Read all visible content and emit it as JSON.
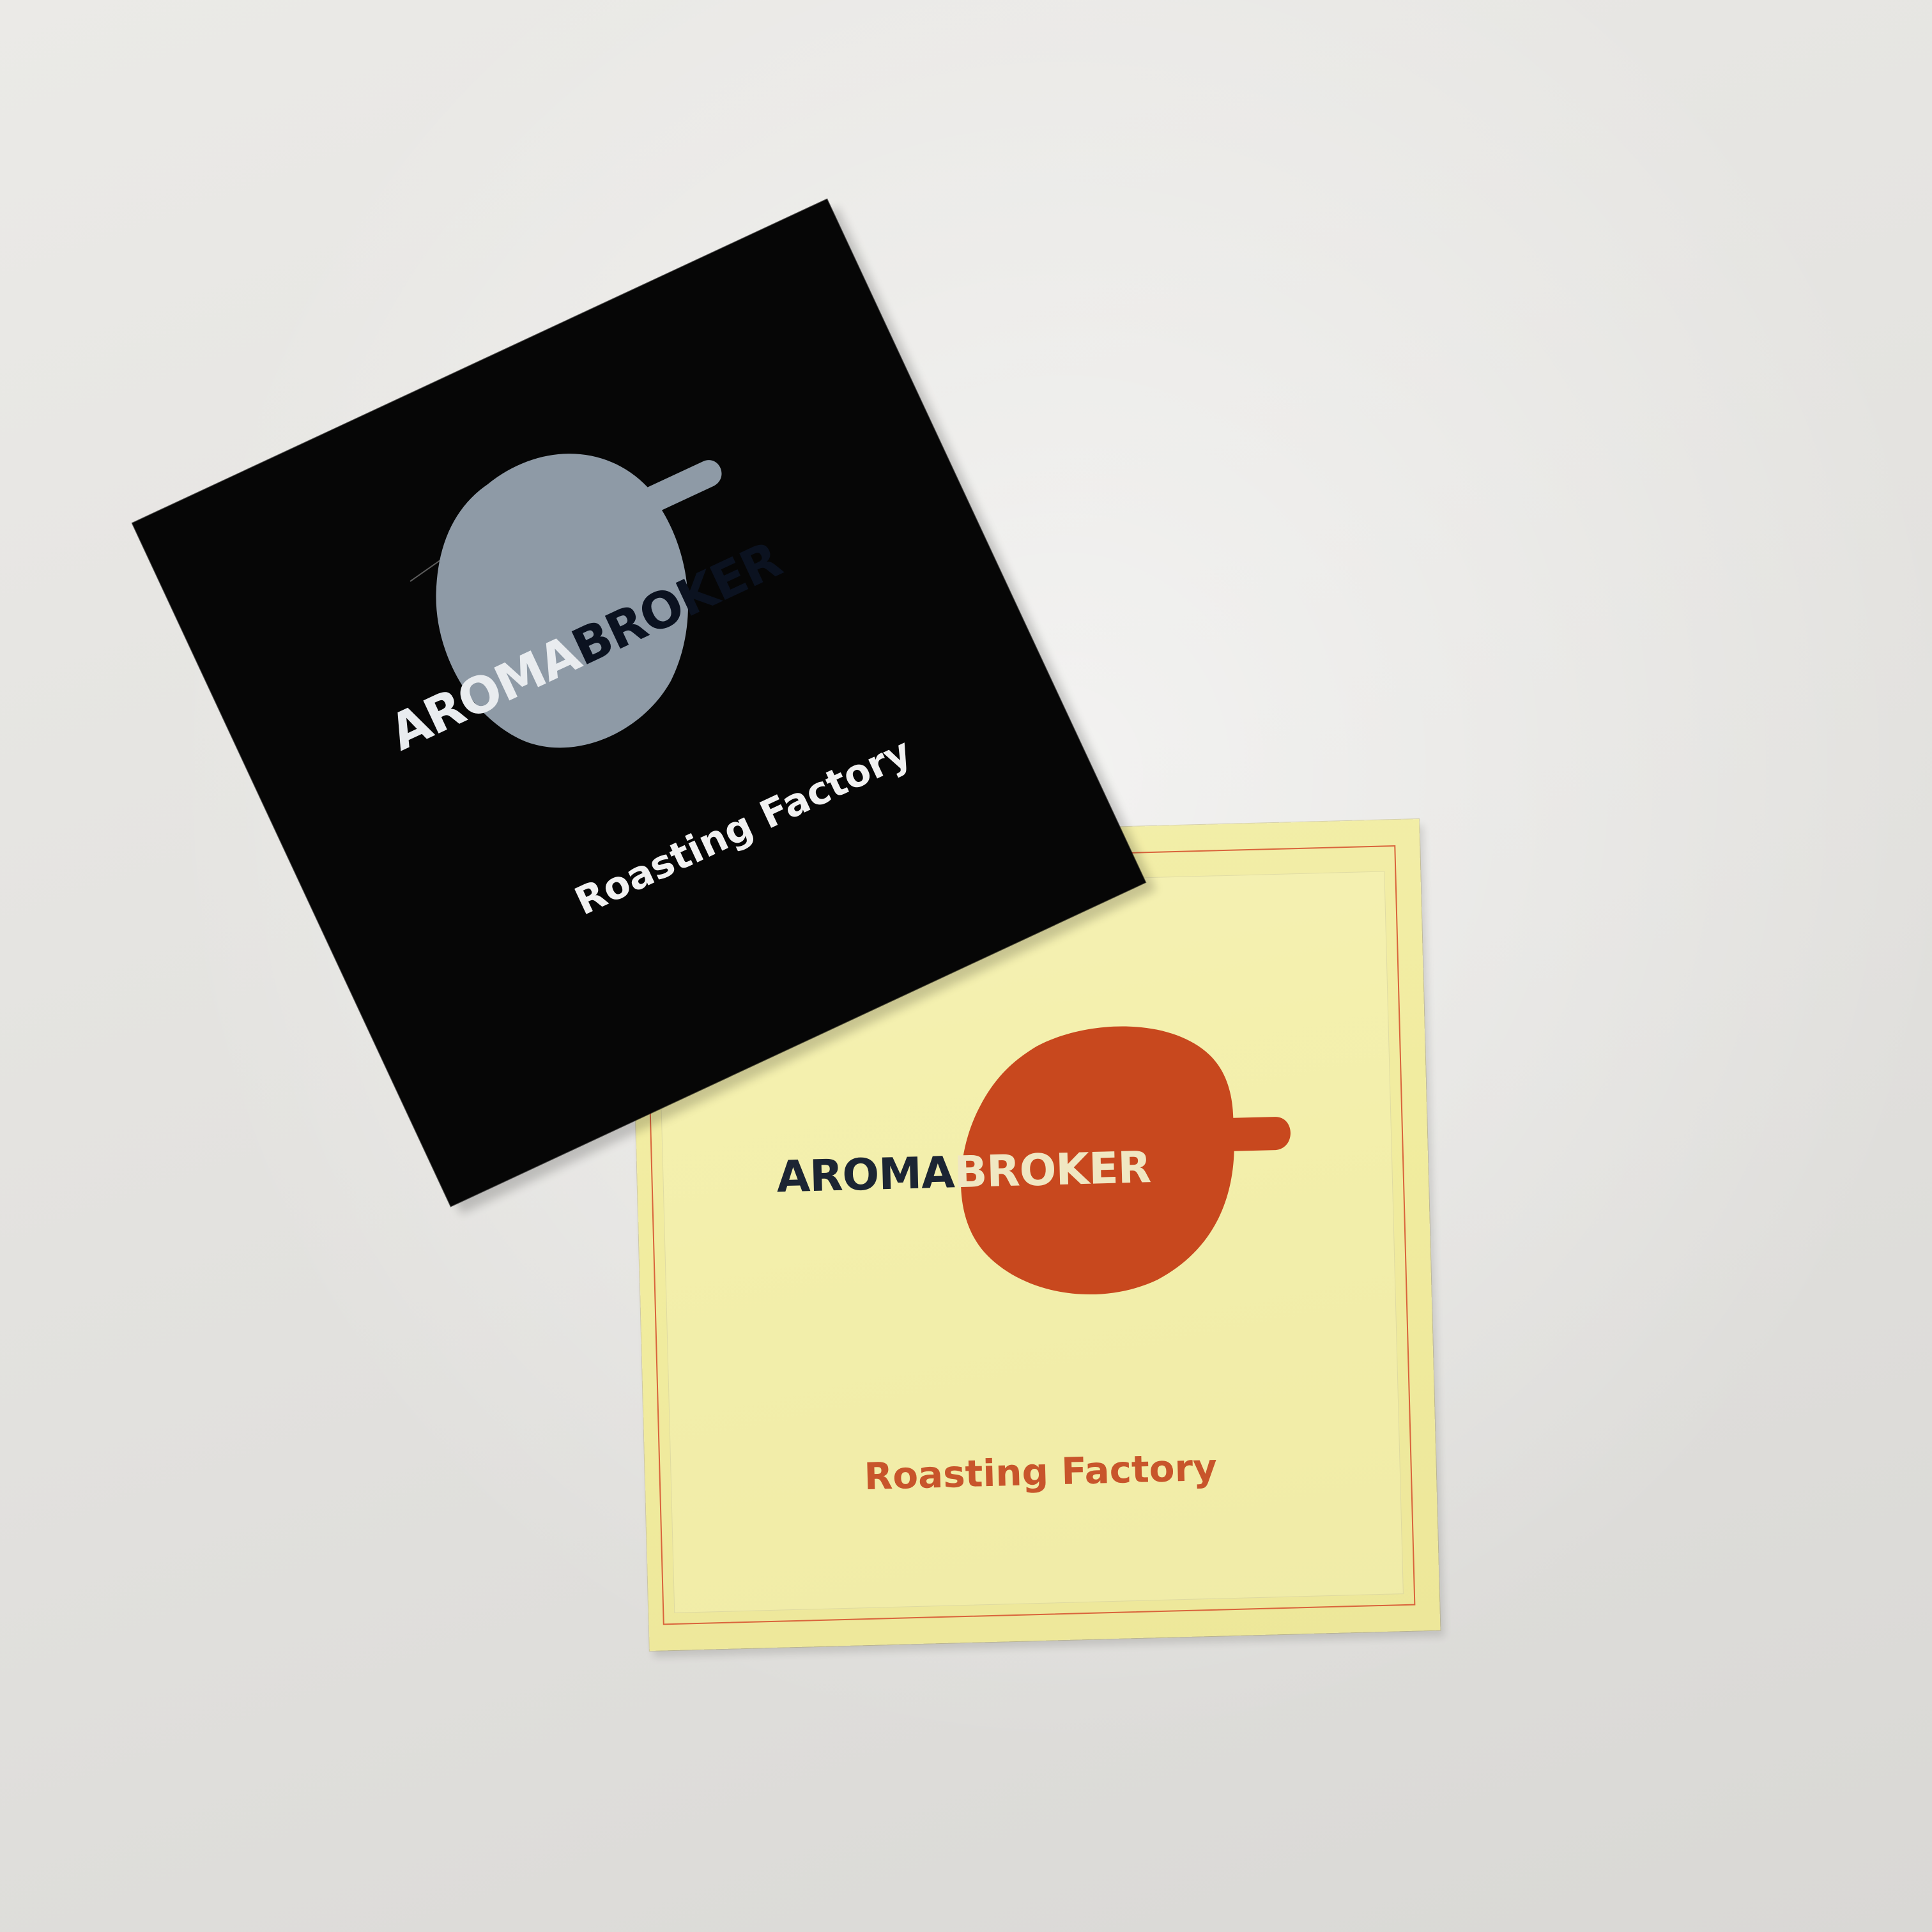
{
  "stickers": {
    "black": {
      "brand_first": "AROMA",
      "brand_second": "BROKER",
      "tagline": "Roasting Factory",
      "background_color": "#060606",
      "blob_color": "#8e9aa6"
    },
    "yellow": {
      "brand_first": "AROMA",
      "brand_second": "BROKER",
      "tagline": "Roasting Factory",
      "background_color": "#f1ec9f",
      "blob_color": "#c8481e",
      "frame_color": "#d9633b"
    }
  },
  "background_color": "#e4e3e0"
}
